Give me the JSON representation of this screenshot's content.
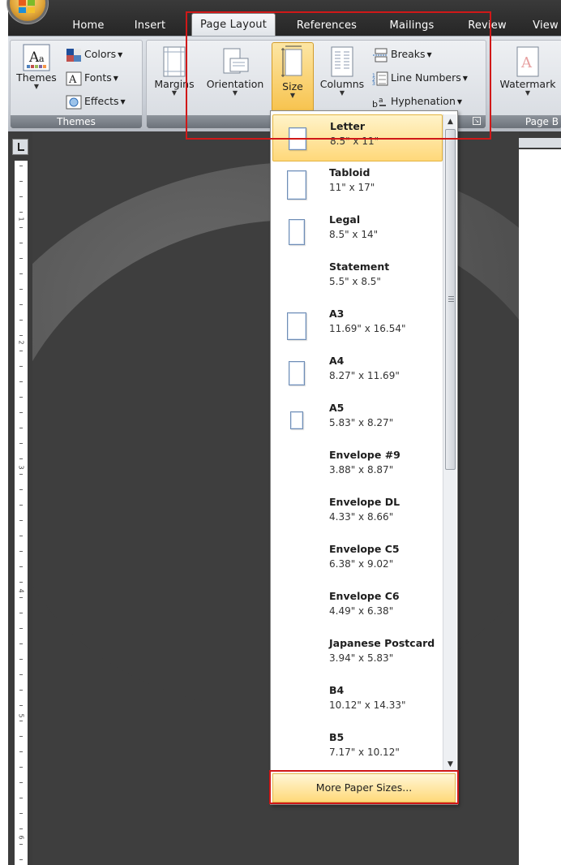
{
  "tabs": [
    {
      "id": "home",
      "label": "Home"
    },
    {
      "id": "insert",
      "label": "Insert"
    },
    {
      "id": "page-layout",
      "label": "Page Layout",
      "active": true
    },
    {
      "id": "references",
      "label": "References"
    },
    {
      "id": "mailings",
      "label": "Mailings"
    },
    {
      "id": "review",
      "label": "Review"
    },
    {
      "id": "view",
      "label": "View"
    }
  ],
  "ribbon": {
    "themes_group": {
      "label": "Themes",
      "themes_button": "Themes",
      "colors": "Colors",
      "fonts": "Fonts",
      "effects": "Effects"
    },
    "page_setup_group": {
      "margins": "Margins",
      "orientation": "Orientation",
      "size": "Size",
      "columns": "Columns",
      "breaks": "Breaks",
      "line_numbers": "Line Numbers",
      "hyphenation": "Hyphenation"
    },
    "page_background_group": {
      "label": "Page B",
      "watermark": "Watermark"
    }
  },
  "ruler": {
    "numbers": [
      "1",
      "2",
      "3",
      "4",
      "5",
      "6"
    ]
  },
  "size_menu": {
    "items": [
      {
        "name": "Letter",
        "dims": "8.5\" x 11\"",
        "selected": true
      },
      {
        "name": "Tabloid",
        "dims": "11\" x 17\""
      },
      {
        "name": "Legal",
        "dims": "8.5\" x 14\""
      },
      {
        "name": "Statement",
        "dims": "5.5\" x 8.5\""
      },
      {
        "name": "A3",
        "dims": "11.69\" x 16.54\""
      },
      {
        "name": "A4",
        "dims": "8.27\" x 11.69\""
      },
      {
        "name": "A5",
        "dims": "5.83\" x 8.27\""
      },
      {
        "name": "Envelope #9",
        "dims": "3.88\" x 8.87\""
      },
      {
        "name": "Envelope DL",
        "dims": "4.33\" x 8.66\""
      },
      {
        "name": "Envelope C5",
        "dims": "6.38\" x 9.02\""
      },
      {
        "name": "Envelope C6",
        "dims": "4.49\" x 6.38\""
      },
      {
        "name": "Japanese Postcard",
        "dims": "3.94\" x 5.83\""
      },
      {
        "name": "B4",
        "dims": "10.12\" x 14.33\""
      },
      {
        "name": "B5",
        "dims": "7.17\" x 10.12\""
      }
    ],
    "more_label": "More Paper Sizes..."
  },
  "colors": {
    "annotation": "#d01818",
    "selection": "#ffd87a",
    "tabbar": "#2e2e2e"
  },
  "icons": {
    "office_button": "office-logo-icon",
    "themes": "themes-icon",
    "colors": "colors-icon",
    "fonts": "fonts-icon",
    "effects": "effects-icon",
    "margins": "margins-icon",
    "orientation": "orientation-icon",
    "size": "size-icon",
    "columns": "columns-icon",
    "breaks": "breaks-icon",
    "line_numbers": "line-numbers-icon",
    "hyphenation": "hyphenation-icon",
    "watermark": "watermark-icon"
  }
}
